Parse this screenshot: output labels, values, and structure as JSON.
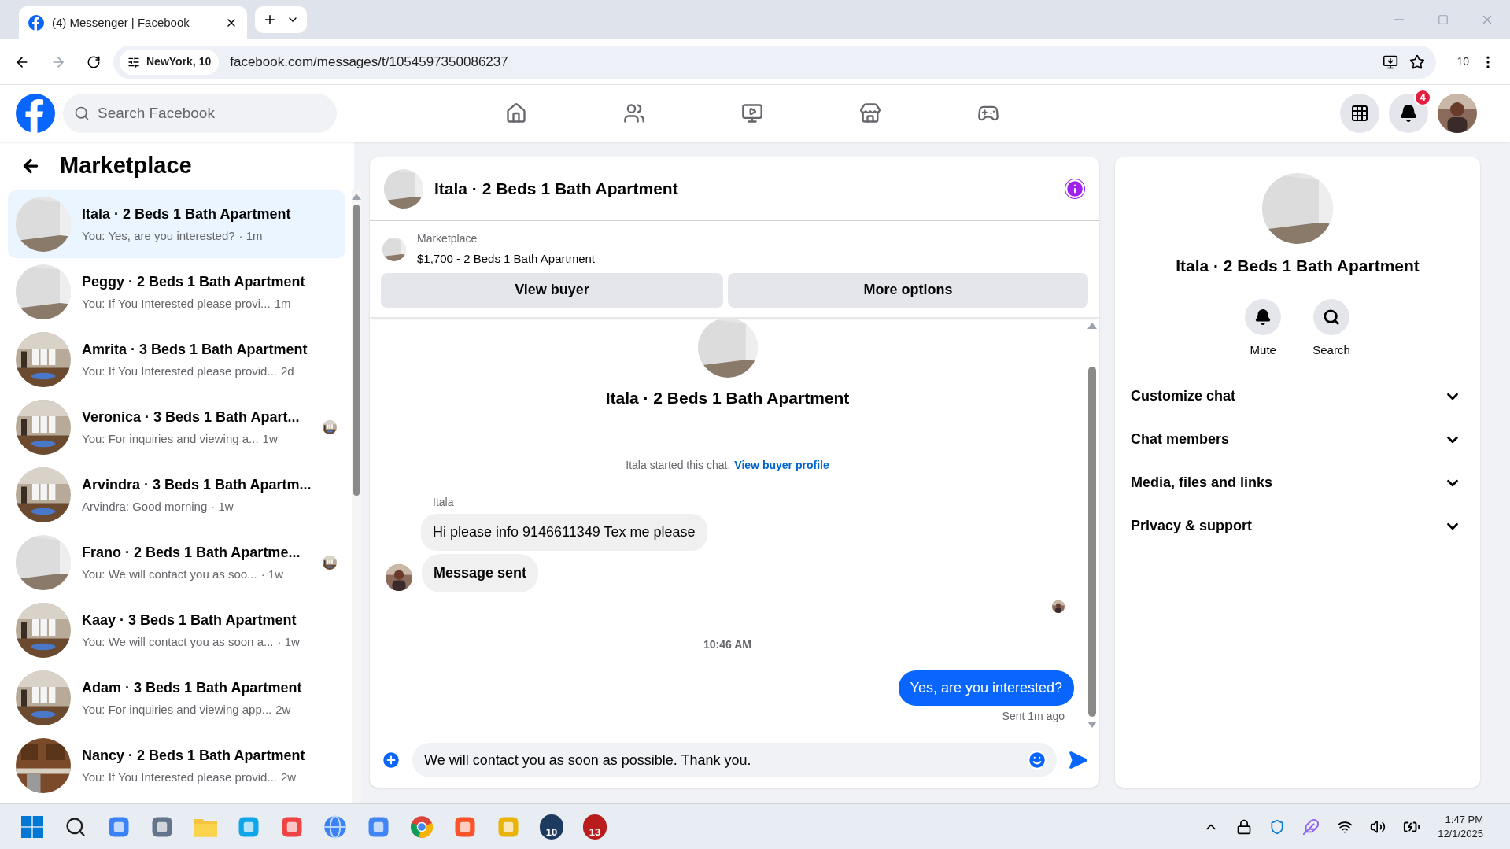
{
  "browser": {
    "tab_title": "(4) Messenger | Facebook",
    "location_chip": "NewYork, 10",
    "url": "facebook.com/messages/t/1054597350086237",
    "profile_count": "10"
  },
  "header": {
    "search_placeholder": "Search Facebook",
    "notification_count": "4"
  },
  "sidebar": {
    "title": "Marketplace",
    "conversations": [
      {
        "title": "Itala · 2 Beds 1 Bath Apartment",
        "preview": "You: Yes, are you interested?",
        "time": "· 1m",
        "selected": true,
        "read_receipt": false
      },
      {
        "title": "Peggy · 2 Beds 1 Bath Apartment",
        "preview": "You: If You Interested please provi...",
        "time": "1m",
        "selected": false,
        "read_receipt": false
      },
      {
        "title": "Amrita · 3 Beds 1 Bath Apartment",
        "preview": "You: If You Interested please provid...",
        "time": "2d",
        "selected": false,
        "read_receipt": false
      },
      {
        "title": "Veronica · 3 Beds 1 Bath Apart...",
        "preview": "You: For inquiries and viewing a...",
        "time": "1w",
        "selected": false,
        "read_receipt": true
      },
      {
        "title": "Arvindra · 3 Beds 1 Bath Apartm...",
        "preview": "Arvindra: Good morning",
        "time": "· 1w",
        "selected": false,
        "read_receipt": false
      },
      {
        "title": "Frano · 2 Beds 1 Bath Apartme...",
        "preview": "You: We will contact you as soo...",
        "time": "· 1w",
        "selected": false,
        "read_receipt": true
      },
      {
        "title": "Kaay · 3 Beds 1 Bath Apartment",
        "preview": "You: We will contact you as soon a...",
        "time": "· 1w",
        "selected": false,
        "read_receipt": false
      },
      {
        "title": "Adam · 3 Beds 1 Bath Apartment",
        "preview": "You: For inquiries and viewing app...",
        "time": "2w",
        "selected": false,
        "read_receipt": false
      },
      {
        "title": "Nancy · 2 Beds 1 Bath Apartment",
        "preview": "You: If You Interested please provid...",
        "time": "2w",
        "selected": false,
        "read_receipt": false
      }
    ]
  },
  "chat": {
    "title": "Itala · 2 Beds 1 Bath Apartment",
    "listing_label": "Marketplace",
    "listing_text": "$1,700 - 2 Beds 1 Bath Apartment",
    "buttons": [
      "View buyer",
      "More options"
    ],
    "intro_title": "Itala · 2 Beds 1 Bath Apartment",
    "intro_text": "Itala started this chat.",
    "intro_link": "View buyer profile",
    "sender": "Itala",
    "messages": [
      {
        "kind": "incoming",
        "text": "Hi please info 9146611349 Tex me please"
      },
      {
        "kind": "notice",
        "text": "Message sent"
      },
      {
        "kind": "receipt"
      },
      {
        "kind": "timestamp",
        "text": "10:46 AM"
      },
      {
        "kind": "outgoing",
        "text": "Yes, are you interested?",
        "status": "Sent 1m ago"
      }
    ],
    "composer_value": "We will contact you as soon as possible. Thank you."
  },
  "details": {
    "title": "Itala · 2 Beds 1 Bath Apartment",
    "actions": [
      {
        "kind": "mute",
        "label": "Mute"
      },
      {
        "kind": "search",
        "label": "Search"
      }
    ],
    "sections": [
      {
        "label": "Customize chat",
        "expanded": false
      },
      {
        "label": "Chat members",
        "expanded": false
      },
      {
        "label": "Media, files and links",
        "expanded": false
      },
      {
        "label": "Privacy & support",
        "expanded": false
      }
    ]
  },
  "taskbar": {
    "apps": [
      {
        "kind": "start"
      },
      {
        "kind": "search"
      },
      {
        "kind": "app"
      },
      {
        "kind": "app"
      },
      {
        "kind": "folder"
      },
      {
        "kind": "app"
      },
      {
        "kind": "app"
      },
      {
        "kind": "globe"
      },
      {
        "kind": "app"
      },
      {
        "kind": "chrome"
      },
      {
        "kind": "app"
      },
      {
        "kind": "app"
      },
      {
        "kind": "badge",
        "badge": "10"
      },
      {
        "kind": "badge",
        "badge": "13"
      }
    ],
    "time": "1:47 PM",
    "date": "12/1/2025"
  }
}
